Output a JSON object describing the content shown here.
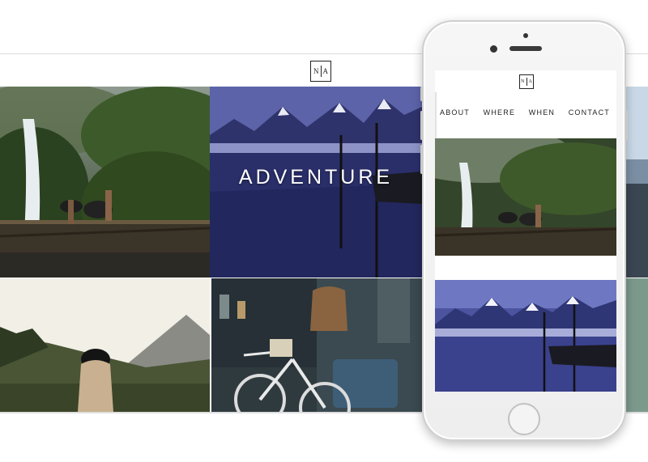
{
  "site": {
    "logo_left": "N",
    "logo_right": "A",
    "hero_word": "ADVENTURE"
  },
  "mobile": {
    "logo_left": "N",
    "logo_right": "A",
    "nav": [
      "ABOUT",
      "WHERE",
      "WHEN",
      "CONTACT"
    ]
  },
  "photos": {
    "waterfall": "waterfall-photo",
    "mountain_lake": "mountain-lake-photo",
    "girl_forest": "girl-forest-photo",
    "bicycle_shop": "bicycle-shop-photo"
  },
  "colors": {
    "ink": "#222222",
    "lake_blue": "#3a3f86",
    "forest_green": "#3e5a2c"
  }
}
